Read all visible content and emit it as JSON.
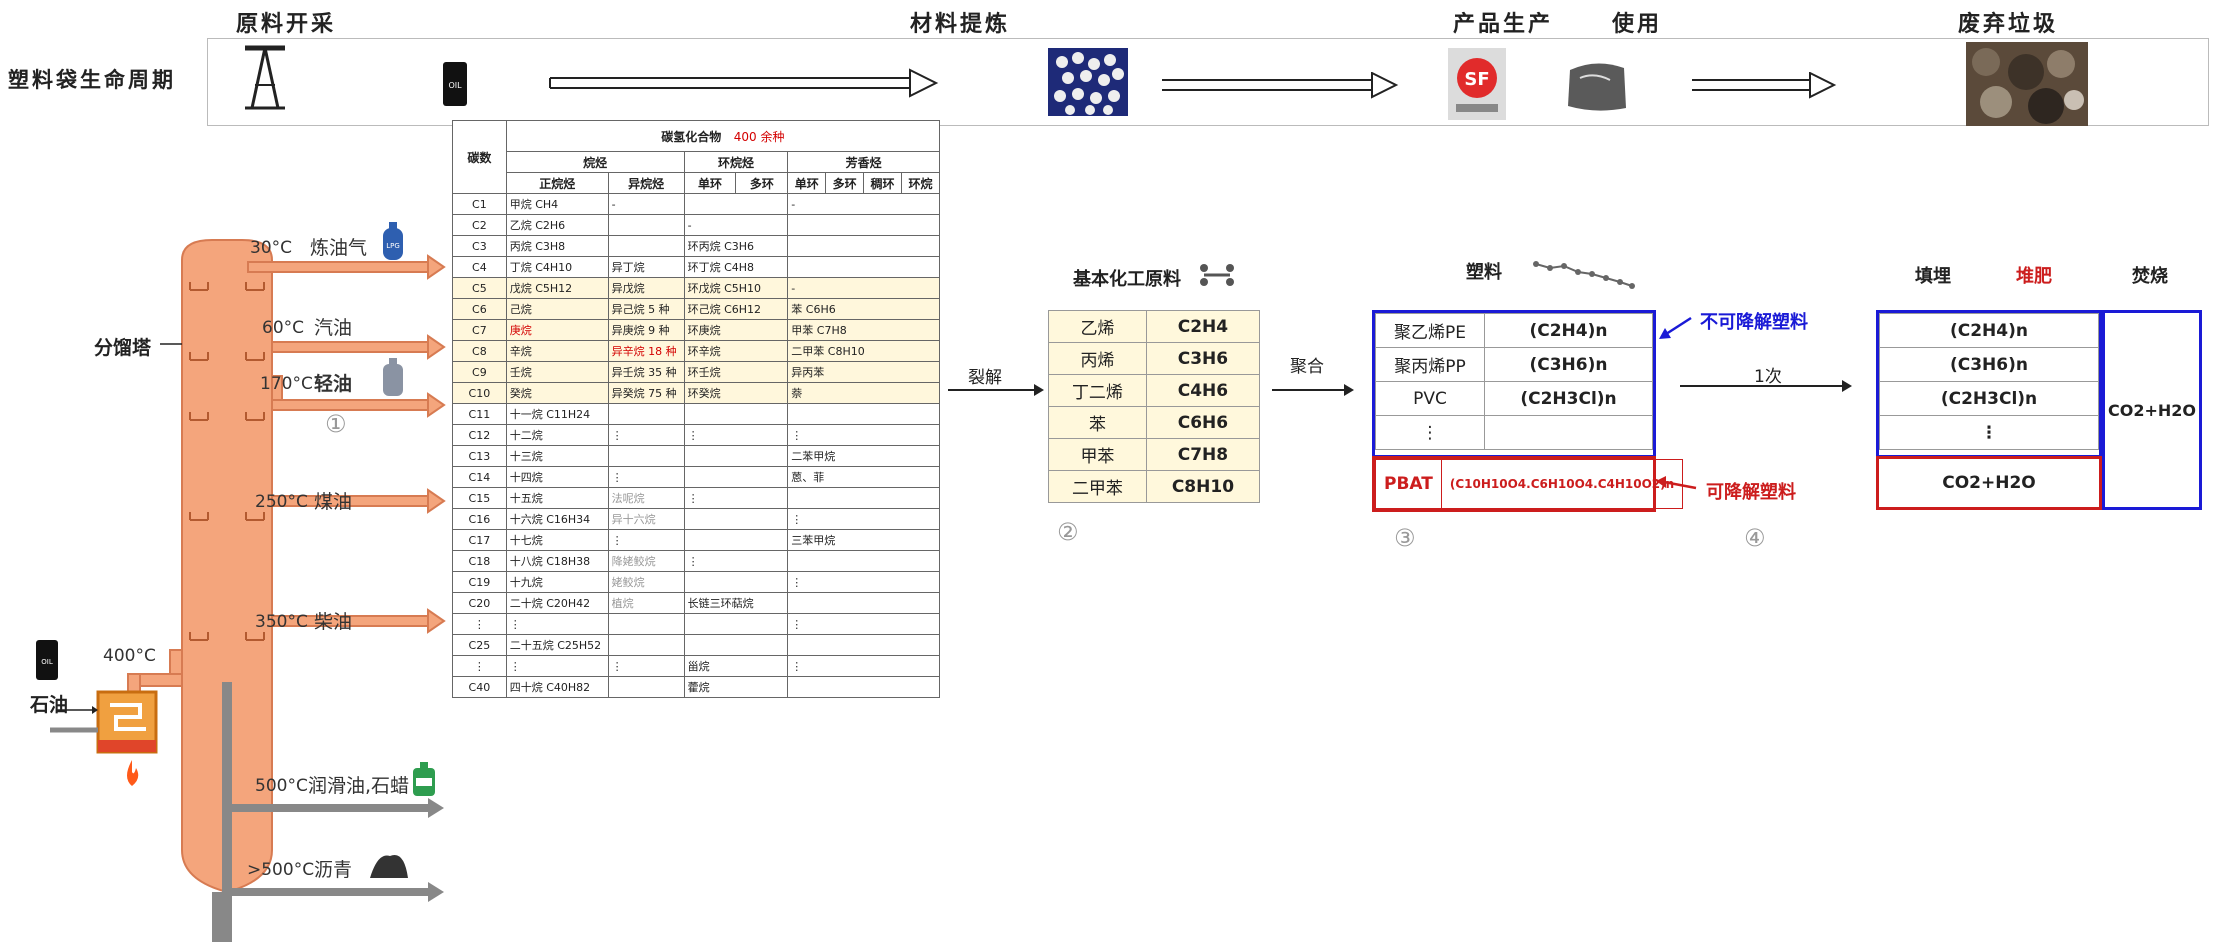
{
  "top": {
    "row_label": "塑料袋生命周期",
    "stages": [
      "原料开采",
      "材料提炼",
      "产品生产",
      "使用",
      "废弃垃圾"
    ]
  },
  "tower": {
    "name": "分馏塔",
    "feed_label": "石油",
    "heater_temp": "400°C",
    "cuts": [
      {
        "temp": "30°C",
        "product": "炼油气"
      },
      {
        "temp": "60°C",
        "product": "汽油"
      },
      {
        "temp": "170°C",
        "product": "轻油"
      },
      {
        "temp": "250°C",
        "product": "煤油"
      },
      {
        "temp": "350°C",
        "product": "柴油"
      },
      {
        "temp": "500°C",
        "product": "润滑油,石蜡"
      },
      {
        "temp": ">500°C",
        "product": "沥青"
      }
    ],
    "circle": "①"
  },
  "hc_table": {
    "header_carbon": "碳数",
    "header_title": "碳氢化合物",
    "header_count": "400 余种",
    "groups": [
      "烷烃",
      "环烷烃",
      "芳香烃"
    ],
    "subgroups": [
      "正烷烃",
      "异烷烃",
      "单环",
      "多环",
      "单环",
      "多环",
      "稠环",
      "环烷"
    ],
    "rows": [
      {
        "c": "C1",
        "n": "甲烷 CH4",
        "i": "-",
        "s": "",
        "a": "-"
      },
      {
        "c": "C2",
        "n": "乙烷 C2H6",
        "i": "",
        "s": "-",
        "a": ""
      },
      {
        "c": "C3",
        "n": "丙烷 C3H8",
        "i": "",
        "s": "环丙烷 C3H6",
        "a": ""
      },
      {
        "c": "C4",
        "n": "丁烷 C4H10",
        "i": "异丁烷",
        "s": "环丁烷 C4H8",
        "a": ""
      },
      {
        "c": "C5",
        "n": "戊烷 C5H12",
        "i": "异戊烷",
        "s": "环戊烷 C5H10",
        "a": "-"
      },
      {
        "c": "C6",
        "n": "己烷",
        "i": "异己烷 5 种",
        "s": "环己烷 C6H12",
        "a": "苯 C6H6"
      },
      {
        "c": "C7",
        "n": "庚烷",
        "i": "异庚烷 9 种",
        "s": "环庚烷",
        "a": "甲苯 C7H8"
      },
      {
        "c": "C8",
        "n": "辛烷",
        "i": "异辛烷 18 种",
        "s": "环辛烷",
        "a": "二甲苯 C8H10"
      },
      {
        "c": "C9",
        "n": "壬烷",
        "i": "异壬烷 35 种",
        "s": "环壬烷",
        "a": "异丙苯"
      },
      {
        "c": "C10",
        "n": "癸烷",
        "i": "异癸烷 75 种",
        "s": "环癸烷",
        "a": "萘"
      },
      {
        "c": "C11",
        "n": "十一烷 C11H24",
        "i": "",
        "s": "",
        "a": ""
      },
      {
        "c": "C12",
        "n": "十二烷",
        "i": "⋮",
        "s": "⋮",
        "a": "⋮"
      },
      {
        "c": "C13",
        "n": "十三烷",
        "i": "",
        "s": "",
        "a": "二苯甲烷"
      },
      {
        "c": "C14",
        "n": "十四烷",
        "i": "⋮",
        "s": "",
        "a": "蒽、菲"
      },
      {
        "c": "C15",
        "n": "十五烷",
        "i": "法呢烷",
        "s": "⋮",
        "a": ""
      },
      {
        "c": "C16",
        "n": "十六烷 C16H34",
        "i": "异十六烷",
        "s": "",
        "a": "⋮"
      },
      {
        "c": "C17",
        "n": "十七烷",
        "i": "⋮",
        "s": "",
        "a": "三苯甲烷"
      },
      {
        "c": "C18",
        "n": "十八烷 C18H38",
        "i": "降姥鲛烷",
        "s": "⋮",
        "a": ""
      },
      {
        "c": "C19",
        "n": "十九烷",
        "i": "姥鲛烷",
        "s": "",
        "a": "⋮"
      },
      {
        "c": "C20",
        "n": "二十烷 C20H42",
        "i": "植烷",
        "s": "长链三环萜烷",
        "a": ""
      },
      {
        "c": "⋮",
        "n": "⋮",
        "i": "",
        "s": "",
        "a": "⋮"
      },
      {
        "c": "C25",
        "n": "二十五烷 C25H52",
        "i": "",
        "s": "",
        "a": ""
      },
      {
        "c": "⋮",
        "n": "⋮",
        "i": "⋮",
        "s": "甾烷",
        "a": "⋮"
      },
      {
        "c": "C40",
        "n": "四十烷 C40H82",
        "i": "",
        "s": "藿烷",
        "a": ""
      }
    ]
  },
  "crack_label": "裂解",
  "raw": {
    "title": "基本化工原料",
    "rows": [
      [
        "乙烯",
        "C2H4"
      ],
      [
        "丙烯",
        "C3H6"
      ],
      [
        "丁二烯",
        "C4H6"
      ],
      [
        "苯",
        "C6H6"
      ],
      [
        "甲苯",
        "C7H8"
      ],
      [
        "二甲苯",
        "C8H10"
      ]
    ],
    "circle": "②"
  },
  "poly_label": "聚合",
  "plastics": {
    "title": "塑料",
    "nondeg": [
      [
        "聚乙烯PE",
        "(C2H4)n"
      ],
      [
        "聚丙烯PP",
        "(C3H6)n"
      ],
      [
        "PVC",
        "(C2H3Cl)n"
      ],
      [
        "⋮",
        ""
      ]
    ],
    "deg": [
      "PBAT",
      "(C10H10O4.C6H10O4.C4H10O2)n"
    ],
    "nondeg_label": "不可降解塑料",
    "deg_label": "可降解塑料",
    "circle": "③"
  },
  "once_label": "1次",
  "disposal": {
    "headers": [
      "填埋",
      "堆肥",
      "焚烧"
    ],
    "landfill": [
      "(C2H4)n",
      "(C3H6)n",
      "(C2H3Cl)n",
      "⋮"
    ],
    "compost": "CO2+H2O",
    "incinerate": "CO2+H2O",
    "circle": "④"
  },
  "colors": {
    "blue": "#1a1ad6",
    "red": "#cc1d1d",
    "pipe": "#f4a57c"
  }
}
